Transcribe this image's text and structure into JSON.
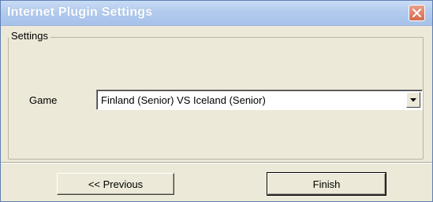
{
  "window": {
    "title": "Internet Plugin Settings"
  },
  "settings_group": {
    "label": "Settings",
    "game_label": "Game",
    "game_value": "Finland (Senior) VS Iceland (Senior)"
  },
  "buttons": {
    "previous": "<< Previous",
    "finish": "Finish"
  },
  "colors": {
    "titlebar": "#b3cbee",
    "close_button": "#d46a4e",
    "dialog_face": "#ece9d8"
  },
  "icons": {
    "close": "close-icon",
    "dropdown": "chevron-down-icon"
  }
}
